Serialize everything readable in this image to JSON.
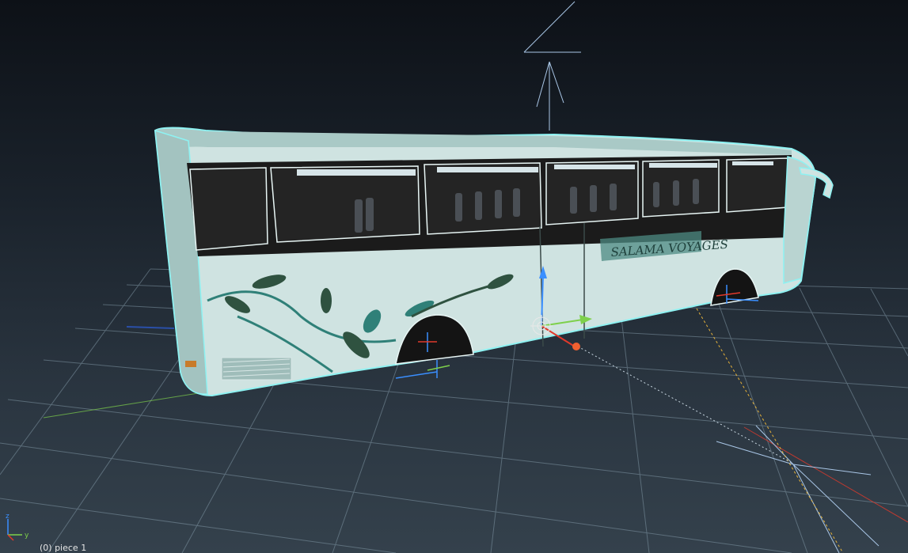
{
  "viewport": {
    "status": "(0) piece 1",
    "colors": {
      "background_top": "#0d1117",
      "background_bottom": "#34414c",
      "grid": "#7f95a3",
      "selection_outline": "#8ef2f2",
      "bus_body": "#cfe3e1",
      "window": "#1b1b1b",
      "leaf_dark": "#2f5240",
      "leaf_teal": "#2f8078"
    }
  },
  "bus": {
    "sign_text": "SALAMA VOYAGES"
  },
  "axis_indicator": {
    "z_label": "z",
    "y_label": "y",
    "z_color": "#3a8fff",
    "y_color": "#7ed04b",
    "x_color": "#e0392b"
  },
  "gizmo": {
    "up_icon": "arrow-up-icon",
    "right_icon": "arrow-right-icon",
    "pivot_icon": "crosshair-icon"
  }
}
